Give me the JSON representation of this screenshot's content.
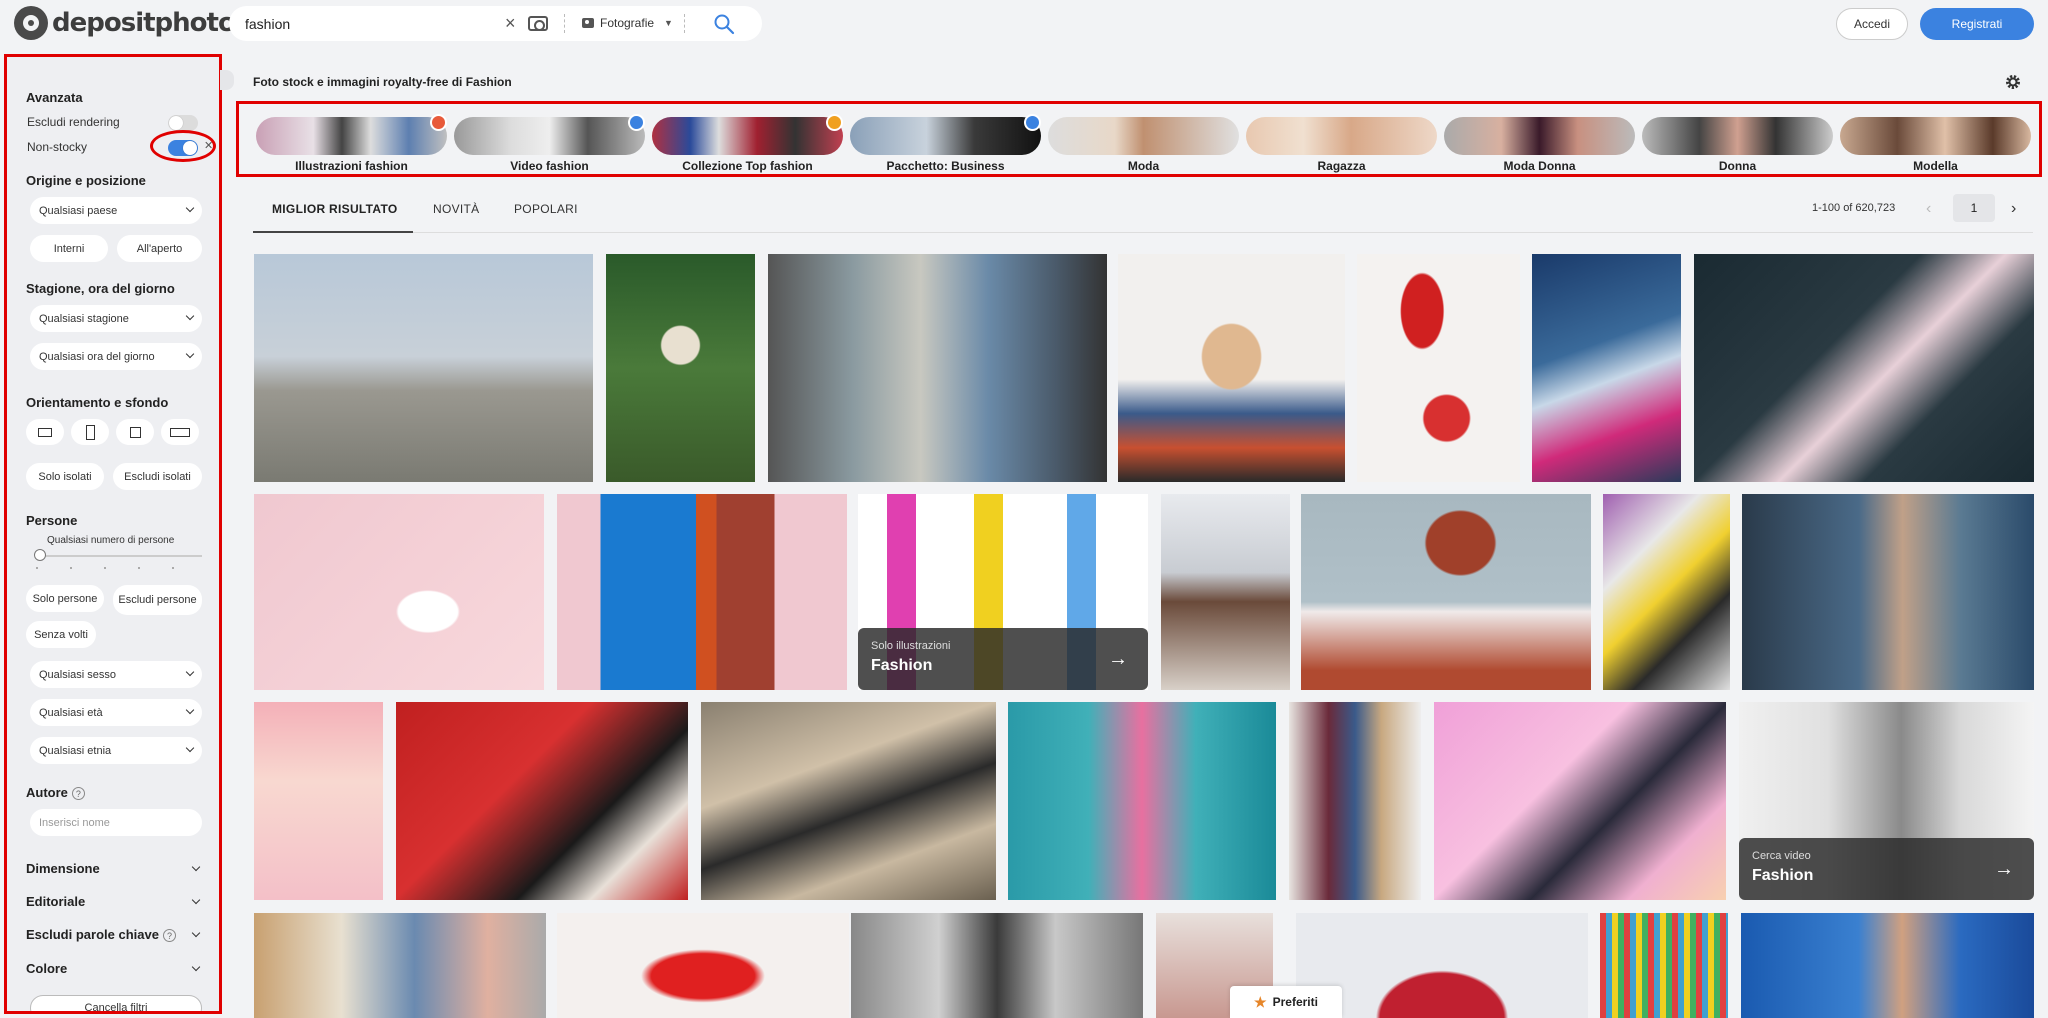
{
  "brand": {
    "name": "depositphotos"
  },
  "search": {
    "value": "fashion",
    "type_label": "Fotografie"
  },
  "header": {
    "login_label": "Accedi",
    "register_label": "Registrati"
  },
  "sidebar": {
    "advanced_title": "Avanzata",
    "exclude_rendering_label": "Escludi rendering",
    "non_stocky_label": "Non-stocky",
    "origin_title": "Origine e posizione",
    "country_select": "Qualsiasi paese",
    "indoor_label": "Interni",
    "outdoor_label": "All'aperto",
    "season_title": "Stagione, ora del giorno",
    "season_select": "Qualsiasi stagione",
    "time_select": "Qualsiasi ora del giorno",
    "orientation_title": "Orientamento e sfondo",
    "only_isolated_label": "Solo isolati",
    "exclude_isolated_label": "Escludi isolati",
    "people_title": "Persone",
    "people_count_label": "Qualsiasi numero di persone",
    "only_people_label": "Solo persone",
    "exclude_people_label": "Escludi persone",
    "no_faces_label": "Senza volti",
    "gender_select": "Qualsiasi sesso",
    "age_select": "Qualsiasi età",
    "ethnicity_select": "Qualsiasi etnia",
    "author_title": "Autore",
    "author_placeholder": "Inserisci nome",
    "dimension_label": "Dimensione",
    "editorial_label": "Editoriale",
    "exclude_keywords_label": "Escludi parole chiave",
    "color_label": "Colore",
    "clear_filters_label": "Cancella filtri"
  },
  "main": {
    "title": "Foto stock e immagini royalty-free di Fashion",
    "related": [
      {
        "label": "Illustrazioni fashion"
      },
      {
        "label": "Video fashion"
      },
      {
        "label": "Collezione Top fashion"
      },
      {
        "label": "Pacchetto: Business"
      },
      {
        "label": "Moda"
      },
      {
        "label": "Ragazza"
      },
      {
        "label": "Moda Donna"
      },
      {
        "label": "Donna"
      },
      {
        "label": "Modella"
      }
    ],
    "tabs": [
      {
        "label": "MIGLIOR RISULTATO"
      },
      {
        "label": "NOVITÀ"
      },
      {
        "label": "POPOLARI"
      }
    ],
    "results_count": "1-100 of 620,723",
    "page": "1",
    "cards": {
      "illustrations_small": "Solo illustrazioni",
      "illustrations_big": "Fashion",
      "video_small": "Cerca video",
      "video_big": "Fashion"
    },
    "favorites_label": "Preferiti"
  },
  "colors": {
    "accent": "#3b82e0",
    "highlight": "#e00000"
  }
}
